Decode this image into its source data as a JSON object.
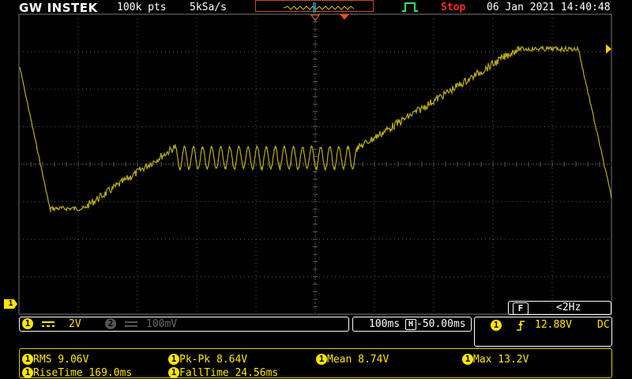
{
  "top_bar": {
    "brand": "GW INSTEK",
    "record_length": "100k pts",
    "sample_rate": "5kSa/s",
    "run_state": "Stop",
    "datetime": "06 Jan 2021 14:40:48"
  },
  "filter_box": {
    "icon": "F",
    "value": "<2Hz"
  },
  "channel_bar": {
    "ch1_label": "1",
    "ch1_coupling_icon": "dc-coupling-icon",
    "ch1_scale": "2V",
    "ch2_label": "2",
    "ch2_scale": "100mV"
  },
  "timebase": {
    "scale": "100ms",
    "position_icon": "H",
    "position": "-50.00ms"
  },
  "trigger": {
    "source": "1",
    "slope_icon": "rising-edge-icon",
    "level": "12.88V",
    "coupling": "DC"
  },
  "measurements": [
    {
      "label": "RMS 9.06V"
    },
    {
      "label": "Pk-Pk 8.64V"
    },
    {
      "label": "Mean 8.74V"
    },
    {
      "label": "Max 13.2V"
    },
    {
      "label": "RiseTime 169.0ms"
    },
    {
      "label": "FallTime 24.56ms"
    }
  ],
  "ch1_marker": "1",
  "colors": {
    "trace": "#b9ad1c",
    "grid": "#5a5a5a",
    "accent": "#ffe600",
    "stop": "#ff2a2a"
  }
}
